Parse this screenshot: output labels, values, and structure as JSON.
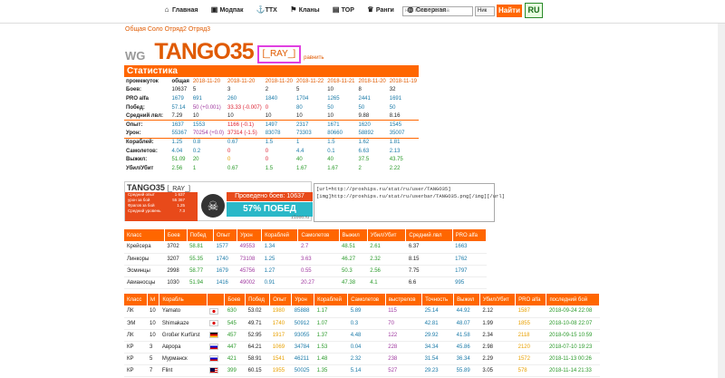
{
  "nav": {
    "items": [
      {
        "icon": "home-icon",
        "glyph": "⌂",
        "label": "Главная"
      },
      {
        "icon": "mods-icon",
        "glyph": "▣",
        "label": "Модпак"
      },
      {
        "icon": "ttx-icon",
        "glyph": "⚓",
        "label": "ТТХ"
      },
      {
        "icon": "clans-icon",
        "glyph": "⚑",
        "label": "Кланы"
      },
      {
        "icon": "top-icon",
        "glyph": "▤",
        "label": "TOP"
      },
      {
        "icon": "ranks-icon",
        "glyph": "♛",
        "label": "Ранги"
      },
      {
        "icon": "server-icon",
        "glyph": "◍",
        "label": "Северная"
      }
    ]
  },
  "search": {
    "placeholder": "ник или тег клана",
    "select": "Ник",
    "button": "Найти",
    "lang": "RU"
  },
  "breadcrumb": "Общая Соло Отряд2 Отряд3",
  "player": {
    "class": "WG",
    "name": "TANGO35",
    "clan": "[_RAY_]",
    "compare": "равнить"
  },
  "stats": {
    "title": "Статистика",
    "dates": [
      "промежуток",
      "общая",
      "2018-11-20",
      "2018-11-20",
      "2018-11-20",
      "2018-11-22",
      "2018-11-21",
      "2018-11-20",
      "2018-11-19"
    ],
    "rows": [
      {
        "label": "Боев:",
        "vals": [
          "10637",
          "5",
          "3",
          "2",
          "5",
          "10",
          "8",
          "32"
        ],
        "cls": "c-k",
        "sep": false
      },
      {
        "label": "PRO alfa",
        "vals": [
          "1679",
          "691",
          "260",
          "1840",
          "1704",
          "1265",
          "2441",
          "1691"
        ],
        "cls": "c-b",
        "sep": false
      },
      {
        "label": "Побед:",
        "vals": [
          "57.14",
          "50 (+0.001)",
          "33.33 (-0.007)",
          "0",
          "80",
          "50",
          "50",
          "50"
        ],
        "cls": "c-b",
        "sep": false
      },
      {
        "label": "Средний лвл:",
        "vals": [
          "7.29",
          "10",
          "10",
          "10",
          "10",
          "10",
          "9.88",
          "8.16"
        ],
        "cls": "c-k",
        "sep": false
      },
      {
        "label": "Опыт:",
        "vals": [
          "1637",
          "1553",
          "1166 (-0.1)",
          "1497",
          "2317",
          "1671",
          "1620",
          "1545"
        ],
        "cls": "c-b",
        "sep": true
      },
      {
        "label": "Урон:",
        "vals": [
          "55367",
          "70254 (+0.0)",
          "37314 (-1.5)",
          "83078",
          "73303",
          "80660",
          "58892",
          "35007"
        ],
        "cls": "c-b",
        "sep": false
      },
      {
        "label": "Кораблей:",
        "vals": [
          "1.25",
          "0.8",
          "0.67",
          "1.5",
          "1",
          "1.5",
          "1.62",
          "1.81"
        ],
        "cls": "c-b",
        "sep": true
      },
      {
        "label": "Самолетов:",
        "vals": [
          "4.04",
          "0.2",
          "0",
          "0",
          "4.4",
          "0.1",
          "6.63",
          "2.13"
        ],
        "cls": "c-b",
        "sep": false
      },
      {
        "label": "Выжил:",
        "vals": [
          "51.09",
          "20",
          "0",
          "0",
          "40",
          "40",
          "37.5",
          "43.75"
        ],
        "cls": "c-g",
        "sep": false
      },
      {
        "label": "Убил/Убит",
        "vals": [
          "2.56",
          "1",
          "0.67",
          "1.5",
          "1.67",
          "1.67",
          "2",
          "2.22"
        ],
        "cls": "c-g",
        "sep": false
      }
    ]
  },
  "signature": {
    "name": "TANGO35",
    "clan": "[_RAY_]",
    "lines": [
      [
        "Средний опыт",
        "1 637"
      ],
      [
        "урон за бой",
        "55 367"
      ],
      [
        "Фрагов за бой",
        "1.25"
      ],
      [
        "Средний уровень",
        "7.3"
      ]
    ],
    "battles": "Проведено боев: 10637",
    "winrate": "57% ПОБЕД",
    "site": "z1ooo.ru"
  },
  "code": "[url=http://proships.ru/stat/ru/user/TANGO35]\n[img]http://proships.ru/stat/ru/userbar/TANGO35.png[/img][/url]",
  "classes": {
    "headers": [
      "Класс",
      "Боев",
      "Побед",
      "Опыт",
      "Урон",
      "Кораблей",
      "Самолетов",
      "Выжил",
      "Убил/Убит",
      "Средний лвл",
      "PRO alfa"
    ],
    "rows": [
      [
        "Крейсера",
        "3702",
        "58.81",
        "1577",
        "49553",
        "1.34",
        "2.7",
        "48.51",
        "2.61",
        "6.37",
        "1663"
      ],
      [
        "Линкоры",
        "3207",
        "55.35",
        "1740",
        "73108",
        "1.25",
        "3.63",
        "46.27",
        "2.32",
        "8.15",
        "1762"
      ],
      [
        "Эсминцы",
        "2998",
        "58.77",
        "1679",
        "45756",
        "1.27",
        "0.55",
        "50.3",
        "2.56",
        "7.75",
        "1797"
      ],
      [
        "Авианосцы",
        "1030",
        "51.94",
        "1416",
        "49002",
        "0.91",
        "20.27",
        "47.38",
        "4.1",
        "6.6",
        "995"
      ]
    ]
  },
  "ships": {
    "headers": [
      "Класс",
      "lvl",
      "Корабль",
      "",
      "Боев",
      "Побед",
      "Опыт",
      "Урон",
      "Кораблей",
      "Самолетов",
      "выстрелов",
      "Точность",
      "Выжил",
      "Убил/Убит",
      "PRO alfa",
      "последний бой"
    ],
    "rows": [
      {
        "cls": "ЛК",
        "lvl": "10",
        "name": "Yamato",
        "flag": "f-jp",
        "vals": [
          "630",
          "53.02",
          "1980",
          "85888",
          "1.17",
          "5.89",
          "115",
          "25.14",
          "44.92",
          "2.12",
          "1587",
          "2018-09-24 22:08"
        ]
      },
      {
        "cls": "ЭМ",
        "lvl": "10",
        "name": "Shimakaze",
        "flag": "f-jp",
        "vals": [
          "545",
          "49.71",
          "1740",
          "50912",
          "1.07",
          "0.3",
          "70",
          "42.81",
          "48.07",
          "1.99",
          "1855",
          "2018-10-08 22:07"
        ]
      },
      {
        "cls": "ЛК",
        "lvl": "10",
        "name": "Großer Kurfürst",
        "flag": "f-de",
        "vals": [
          "457",
          "52.95",
          "1917",
          "93055",
          "1.37",
          "4.48",
          "122",
          "29.92",
          "41.58",
          "2.34",
          "2118",
          "2018-09-15 10:59"
        ]
      },
      {
        "cls": "КР",
        "lvl": "3",
        "name": "Аврора",
        "flag": "f-ru",
        "vals": [
          "447",
          "64.21",
          "1069",
          "34784",
          "1.53",
          "0.04",
          "228",
          "34.34",
          "45.86",
          "2.98",
          "2120",
          "2018-07-10 19:23"
        ]
      },
      {
        "cls": "КР",
        "lvl": "5",
        "name": "Мурманск",
        "flag": "f-ru",
        "vals": [
          "421",
          "58.91",
          "1541",
          "46211",
          "1.48",
          "2.32",
          "238",
          "31.54",
          "36.34",
          "2.29",
          "1572",
          "2018-11-13 00:26"
        ]
      },
      {
        "cls": "КР",
        "lvl": "7",
        "name": "Flint",
        "flag": "f-us",
        "vals": [
          "399",
          "60.15",
          "1955",
          "50025",
          "1.35",
          "5.14",
          "527",
          "29.23",
          "55.89",
          "3.05",
          "578",
          "2018-11-14 21:33"
        ]
      }
    ]
  }
}
